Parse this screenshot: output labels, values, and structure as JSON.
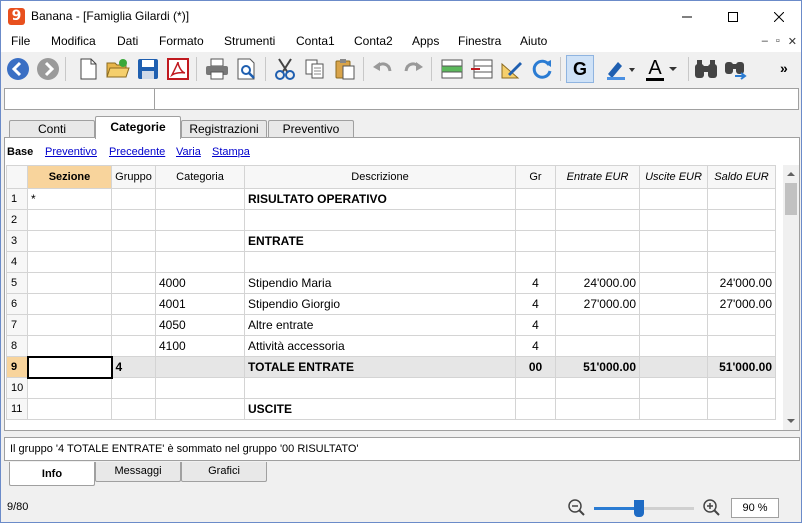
{
  "window": {
    "title": "Banana - [Famiglia Gilardi (*)]",
    "logo": "9"
  },
  "menu": [
    "File",
    "Modifica",
    "Dati",
    "Formato",
    "Strumenti",
    "Conta1",
    "Conta2",
    "Apps",
    "Finestra",
    "Aiuto"
  ],
  "toolbar": {
    "bold_label": "G",
    "font_color_label": "A",
    "overflow": "»"
  },
  "tabs": [
    "Conti",
    "Categorie",
    "Registrazioni",
    "Preventivo"
  ],
  "active_tab": "Categorie",
  "views": [
    "Base",
    "Preventivo",
    "Precedente",
    "Varia",
    "Stampa"
  ],
  "columns": [
    "Sezione",
    "Gruppo",
    "Categoria",
    "Descrizione",
    "Gr",
    "Entrate EUR",
    "Uscite EUR",
    "Saldo EUR"
  ],
  "rows": [
    {
      "n": "1",
      "sezione": "*",
      "gruppo": "",
      "categoria": "",
      "descrizione": "RISULTATO OPERATIVO",
      "gr": "",
      "entrate": "",
      "uscite": "",
      "saldo": ""
    },
    {
      "n": "2",
      "sezione": "",
      "gruppo": "",
      "categoria": "",
      "descrizione": "",
      "gr": "",
      "entrate": "",
      "uscite": "",
      "saldo": ""
    },
    {
      "n": "3",
      "sezione": "",
      "gruppo": "",
      "categoria": "",
      "descrizione": "ENTRATE",
      "gr": "",
      "entrate": "",
      "uscite": "",
      "saldo": ""
    },
    {
      "n": "4",
      "sezione": "",
      "gruppo": "",
      "categoria": "",
      "descrizione": "",
      "gr": "",
      "entrate": "",
      "uscite": "",
      "saldo": ""
    },
    {
      "n": "5",
      "sezione": "",
      "gruppo": "",
      "categoria": "4000",
      "descrizione": "Stipendio Maria",
      "gr": "4",
      "entrate": "24'000.00",
      "uscite": "",
      "saldo": "24'000.00"
    },
    {
      "n": "6",
      "sezione": "",
      "gruppo": "",
      "categoria": "4001",
      "descrizione": "Stipendio Giorgio",
      "gr": "4",
      "entrate": "27'000.00",
      "uscite": "",
      "saldo": "27'000.00"
    },
    {
      "n": "7",
      "sezione": "",
      "gruppo": "",
      "categoria": "4050",
      "descrizione": "Altre entrate",
      "gr": "4",
      "entrate": "",
      "uscite": "",
      "saldo": ""
    },
    {
      "n": "8",
      "sezione": "",
      "gruppo": "",
      "categoria": "4100",
      "descrizione": "Attività accessoria",
      "gr": "4",
      "entrate": "",
      "uscite": "",
      "saldo": ""
    },
    {
      "n": "9",
      "sezione": "",
      "gruppo": "4",
      "categoria": "",
      "descrizione": "TOTALE ENTRATE",
      "gr": "00",
      "entrate": "51'000.00",
      "uscite": "",
      "saldo": "51'000.00"
    },
    {
      "n": "10",
      "sezione": "",
      "gruppo": "",
      "categoria": "",
      "descrizione": "",
      "gr": "",
      "entrate": "",
      "uscite": "",
      "saldo": ""
    },
    {
      "n": "11",
      "sezione": "",
      "gruppo": "",
      "categoria": "",
      "descrizione": "USCITE",
      "gr": "",
      "entrate": "",
      "uscite": "",
      "saldo": ""
    }
  ],
  "status_message": "Il gruppo '4 TOTALE ENTRATE' è sommato nel gruppo '00 RISULTATO'",
  "bottom_tabs": [
    "Info",
    "Messaggi",
    "Grafici"
  ],
  "row_count": "9/80",
  "zoom": {
    "label": "90 %",
    "value_percent": 45
  }
}
